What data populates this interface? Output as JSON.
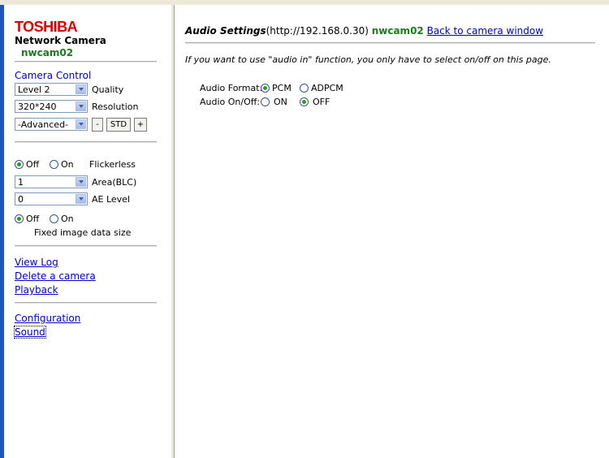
{
  "sidebar": {
    "brand": "TOSHIBA",
    "brand_sub": "Network Camera",
    "camera_name": "nwcam02",
    "camera_control_title": "Camera Control",
    "quality": {
      "value": "Level 2",
      "label": "Quality"
    },
    "resolution": {
      "value": "320*240",
      "label": "Resolution"
    },
    "advanced": {
      "value": "-Advanced-",
      "minus_label": "-",
      "std_label": "STD",
      "plus_label": "+"
    },
    "flickerless": {
      "off_label": "Off",
      "on_label": "On",
      "label": "Flickerless",
      "selected": "off"
    },
    "area_blc": {
      "value": "1",
      "label": "Area(BLC)"
    },
    "ae_level": {
      "value": "0",
      "label": "AE Level"
    },
    "fixed_size": {
      "off_label": "Off",
      "on_label": "On",
      "label": "Fixed image data size",
      "selected": "off"
    },
    "links": {
      "view_log": "View Log",
      "delete_camera": "Delete a camera",
      "playback": "Playback",
      "configuration": "Configuration",
      "sound": "Sound"
    }
  },
  "main": {
    "title": "Audio Settings",
    "url": "(http://192.168.0.30)",
    "camera_name": "nwcam02",
    "back_link": "Back to camera window",
    "info": "If you want to use \"audio in\" function, you only have to select on/off on this page.",
    "audio_format": {
      "label": "Audio Format:",
      "options": [
        "PCM",
        "ADPCM"
      ],
      "selected": "PCM"
    },
    "audio_onoff": {
      "label": "Audio On/Off:",
      "options": [
        "ON",
        "OFF"
      ],
      "selected": "OFF"
    }
  },
  "colors": {
    "brand": "#e00000",
    "camera_name": "#1d7a1d",
    "link": "#0000cc"
  }
}
